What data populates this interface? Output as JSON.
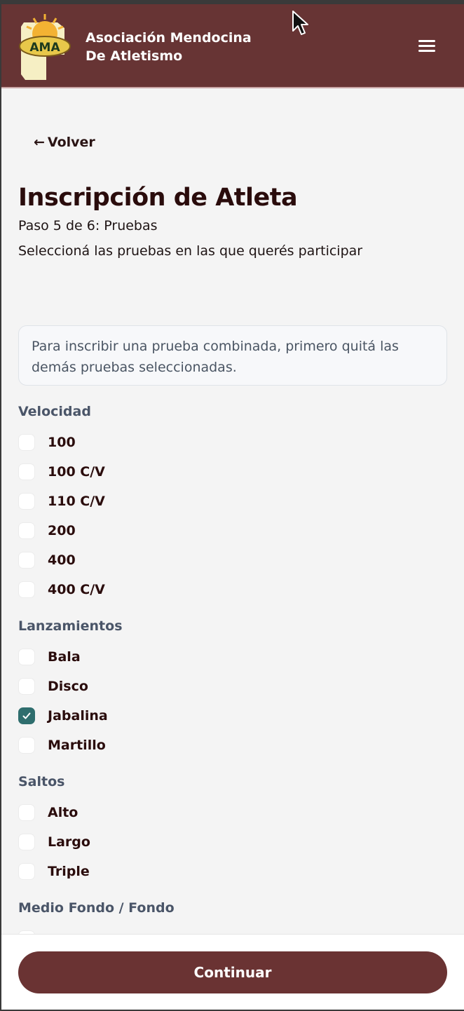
{
  "header": {
    "brand_line1": "Asociación Mendocina",
    "brand_line2": "De Atletismo",
    "logo_text": "AMA",
    "colors": {
      "bar": "#673434",
      "accent_checked": "#2f6e6e"
    }
  },
  "nav": {
    "back_label": "Volver",
    "back_arrow": "←"
  },
  "page": {
    "title": "Inscripción de Atleta",
    "step": "Paso 5 de 6: Pruebas",
    "subtitle": "Seleccioná las pruebas en las que querés participar",
    "notice": "Para inscribir una prueba combinada, primero quitá las demás pruebas seleccionadas."
  },
  "sections": [
    {
      "title": "Velocidad",
      "options": [
        {
          "label": "100",
          "checked": false
        },
        {
          "label": "100 C/V",
          "checked": false
        },
        {
          "label": "110 C/V",
          "checked": false
        },
        {
          "label": "200",
          "checked": false
        },
        {
          "label": "400",
          "checked": false
        },
        {
          "label": "400 C/V",
          "checked": false
        }
      ]
    },
    {
      "title": "Lanzamientos",
      "options": [
        {
          "label": "Bala",
          "checked": false
        },
        {
          "label": "Disco",
          "checked": false
        },
        {
          "label": "Jabalina",
          "checked": true
        },
        {
          "label": "Martillo",
          "checked": false
        }
      ]
    },
    {
      "title": "Saltos",
      "options": [
        {
          "label": "Alto",
          "checked": false
        },
        {
          "label": "Largo",
          "checked": false
        },
        {
          "label": "Triple",
          "checked": false
        }
      ]
    },
    {
      "title": "Medio Fondo / Fondo",
      "options": []
    }
  ],
  "footer": {
    "continue_label": "Continuar"
  }
}
